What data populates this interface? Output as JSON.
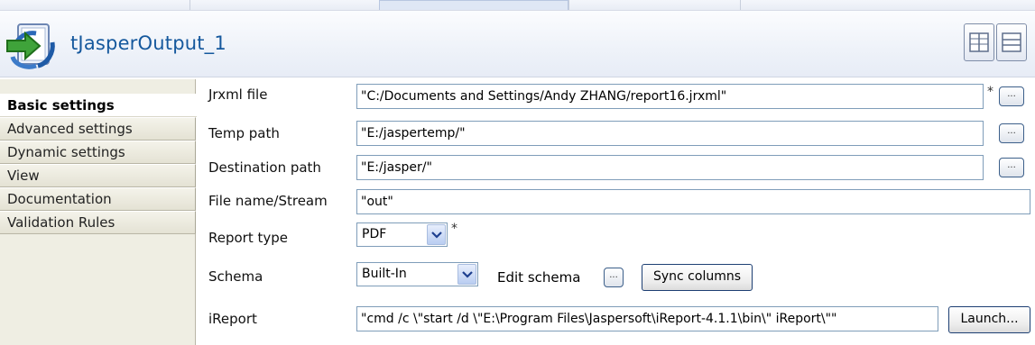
{
  "component": {
    "title": "tJasperOutput_1",
    "icon": "jasper-output-icon"
  },
  "sidebar": {
    "items": [
      {
        "label": "Basic settings",
        "active": true
      },
      {
        "label": "Advanced settings",
        "active": false
      },
      {
        "label": "Dynamic settings",
        "active": false
      },
      {
        "label": "View",
        "active": false
      },
      {
        "label": "Documentation",
        "active": false
      },
      {
        "label": "Validation Rules",
        "active": false
      }
    ]
  },
  "form": {
    "jrxml_file": {
      "label": "Jrxml file",
      "value": "\"C:/Documents and Settings/Andy ZHANG/report16.jrxml\"",
      "required": "*"
    },
    "temp_path": {
      "label": "Temp path",
      "value": "\"E:/jaspertemp/\""
    },
    "destination_path": {
      "label": "Destination path",
      "value": "\"E:/jasper/\""
    },
    "file_name": {
      "label": "File name/Stream",
      "value": "\"out\""
    },
    "report_type": {
      "label": "Report type",
      "value": "PDF",
      "required": "*"
    },
    "schema": {
      "label": "Schema",
      "value": "Built-In",
      "edit_label": "Edit schema",
      "sync_label": "Sync columns"
    },
    "ireport": {
      "label": "iReport",
      "value": "\"cmd /c \\\"start /d \\\"E:\\Program Files\\Jaspersoft\\iReport-4.1.1\\bin\\\" iReport\\\"\"",
      "launch_label": "Launch..."
    },
    "browse_label": "..."
  },
  "colors": {
    "title": "#15589d",
    "sidebar_bg": "#efeee3",
    "header_bg": "#eef2f9"
  }
}
